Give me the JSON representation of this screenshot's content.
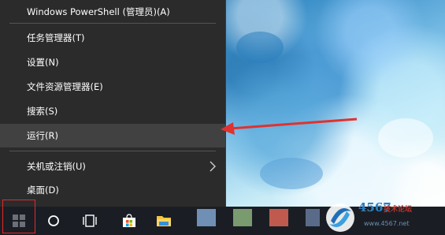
{
  "context_menu": {
    "items": [
      {
        "label": "Windows PowerShell (管理员)(A)"
      },
      {
        "label": "任务管理器(T)"
      },
      {
        "label": "设置(N)"
      },
      {
        "label": "文件资源管理器(E)"
      },
      {
        "label": "搜索(S)"
      },
      {
        "label": "运行(R)",
        "selected": true
      },
      {
        "label": "关机或注销(U)",
        "has_submenu": true
      },
      {
        "label": "桌面(D)"
      }
    ]
  },
  "annotation": {
    "arrow_color": "#e0322f",
    "highlight_color": "#e02a2a"
  },
  "taskbar": {
    "icons": [
      "windows-start-icon",
      "cortana-circle-icon",
      "task-view-icon",
      "microsoft-store-icon",
      "file-explorer-icon"
    ]
  },
  "watermark": {
    "digits": "4567",
    "label": "技术论坛",
    "url": "www.4567.net"
  }
}
